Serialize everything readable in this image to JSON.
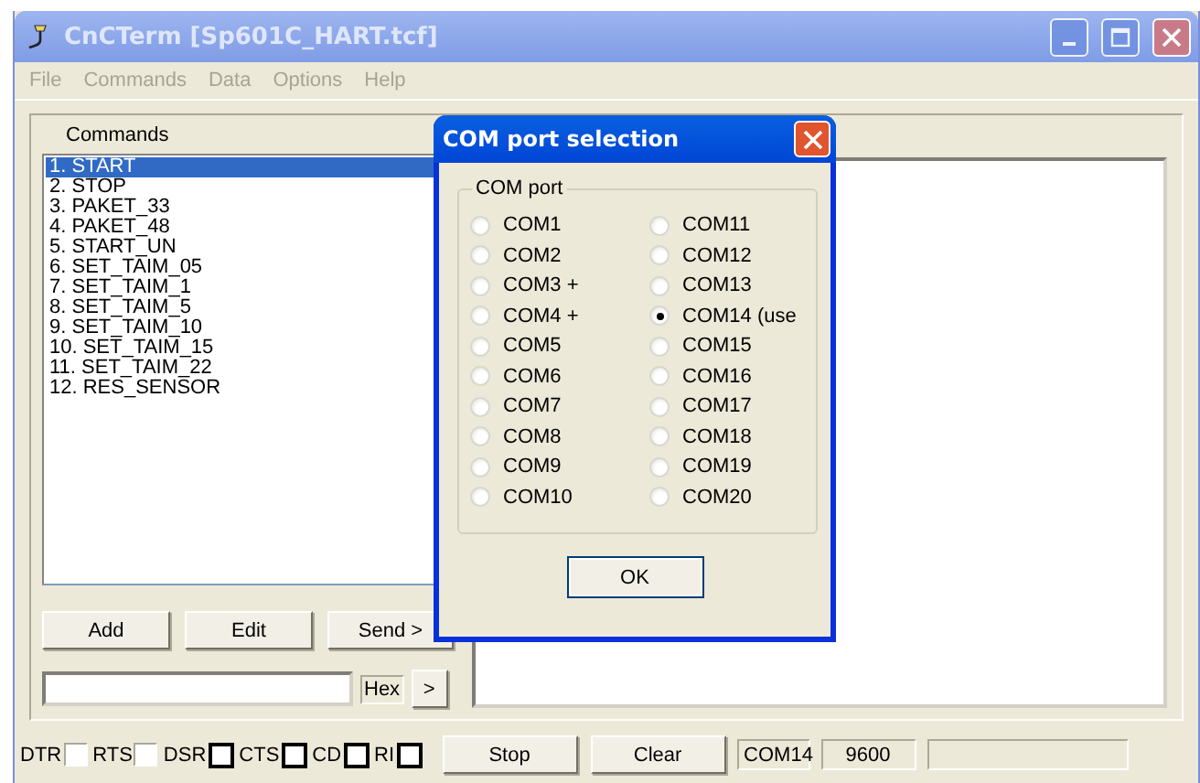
{
  "window": {
    "title": "CnCTerm [Sp601C_HART.tcf]",
    "active": false
  },
  "menu": [
    "File",
    "Commands",
    "Data",
    "Options",
    "Help"
  ],
  "commands_panel": {
    "label": "Commands",
    "items": [
      {
        "label": "1. START",
        "selected": true
      },
      {
        "label": "2. STOP",
        "selected": false
      },
      {
        "label": "3. PAKET_33",
        "selected": false
      },
      {
        "label": "4. PAKET_48",
        "selected": false
      },
      {
        "label": "5. START_UN",
        "selected": false
      },
      {
        "label": "6. SET_TAIM_05",
        "selected": false
      },
      {
        "label": "7. SET_TAIM_1",
        "selected": false
      },
      {
        "label": "8. SET_TAIM_5",
        "selected": false
      },
      {
        "label": "9. SET_TAIM_10",
        "selected": false
      },
      {
        "label": "10. SET_TAIM_15",
        "selected": false
      },
      {
        "label": "11. SET_TAIM_22",
        "selected": false
      },
      {
        "label": "12. RES_SENSOR",
        "selected": false
      }
    ],
    "buttons": [
      "Add",
      "Edit",
      "Send >"
    ],
    "hex_label": "Hex",
    "send_line_button": ">"
  },
  "status_bar": {
    "signals": [
      {
        "label": "DTR",
        "kind": "checkbox",
        "on": false
      },
      {
        "label": "RTS",
        "kind": "checkbox",
        "on": false
      },
      {
        "label": "DSR",
        "kind": "indicator",
        "on": false
      },
      {
        "label": "CTS",
        "kind": "indicator",
        "on": false
      },
      {
        "label": "CD",
        "kind": "indicator",
        "on": false
      },
      {
        "label": "RI",
        "kind": "indicator",
        "on": false
      }
    ],
    "buttons": [
      "Stop",
      "Clear"
    ],
    "port": "COM14",
    "baud": "9600"
  },
  "dialog": {
    "title": "COM port selection",
    "active": true,
    "group_label": "COM port",
    "ok_button": "OK",
    "ports": [
      {
        "label": "COM1",
        "selected": false
      },
      {
        "label": "COM2",
        "selected": false
      },
      {
        "label": "COM3 +",
        "selected": false
      },
      {
        "label": "COM4 +",
        "selected": false
      },
      {
        "label": "COM5",
        "selected": false
      },
      {
        "label": "COM6",
        "selected": false
      },
      {
        "label": "COM7",
        "selected": false
      },
      {
        "label": "COM8",
        "selected": false
      },
      {
        "label": "COM9",
        "selected": false
      },
      {
        "label": "COM10",
        "selected": false
      },
      {
        "label": "COM11",
        "selected": false
      },
      {
        "label": "COM12",
        "selected": false
      },
      {
        "label": "COM13",
        "selected": false
      },
      {
        "label": "COM14 (use",
        "selected": true
      },
      {
        "label": "COM15",
        "selected": false
      },
      {
        "label": "COM16",
        "selected": false
      },
      {
        "label": "COM17",
        "selected": false
      },
      {
        "label": "COM18",
        "selected": false
      },
      {
        "label": "COM19",
        "selected": false
      },
      {
        "label": "COM20",
        "selected": false
      }
    ]
  }
}
